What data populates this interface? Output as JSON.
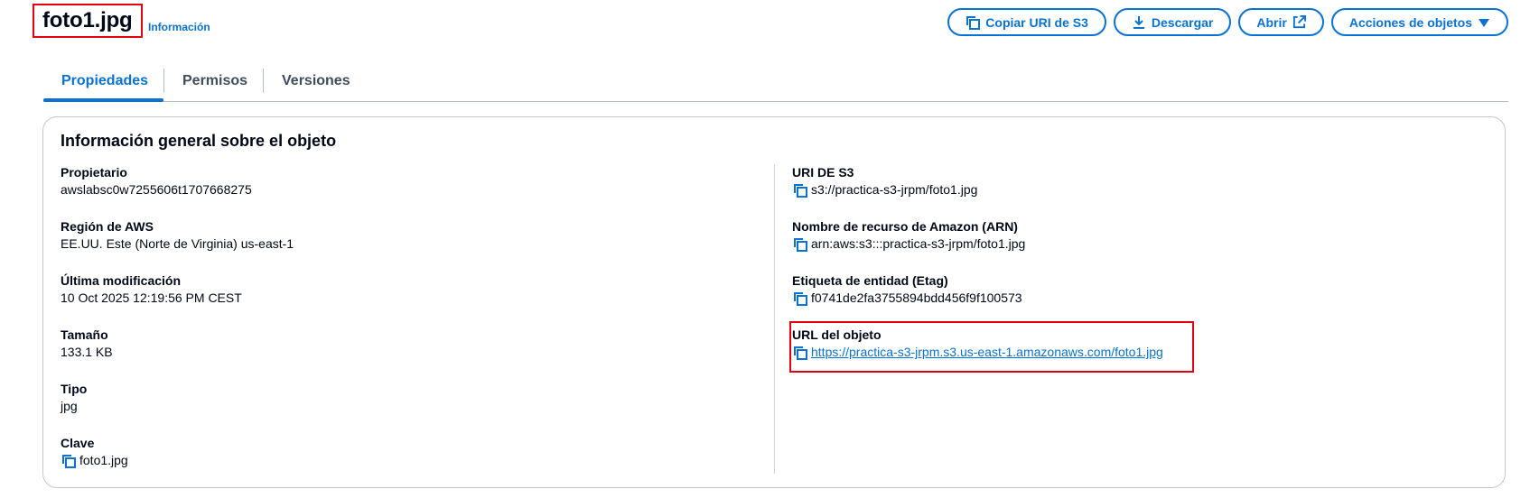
{
  "header": {
    "title": "foto1.jpg",
    "info_link": "Información",
    "buttons": {
      "copy_uri": "Copiar URI de S3",
      "download": "Descargar",
      "open": "Abrir",
      "actions": "Acciones de objetos"
    }
  },
  "tabs": [
    {
      "label": "Propiedades",
      "active": true
    },
    {
      "label": "Permisos",
      "active": false
    },
    {
      "label": "Versiones",
      "active": false
    }
  ],
  "overview": {
    "title": "Información general sobre el objeto",
    "left": [
      {
        "label": "Propietario",
        "value": "awslabsc0w7255606t1707668275"
      },
      {
        "label": "Región de AWS",
        "value": "EE.UU. Este (Norte de Virginia) us-east-1"
      },
      {
        "label": "Última modificación",
        "value": "10 Oct 2025 12:19:56 PM CEST"
      },
      {
        "label": "Tamaño",
        "value": "133.1 KB"
      },
      {
        "label": "Tipo",
        "value": "jpg"
      },
      {
        "label": "Clave",
        "value": "foto1.jpg"
      }
    ],
    "right": [
      {
        "label": "URI DE S3",
        "value": "s3://practica-s3-jrpm/foto1.jpg"
      },
      {
        "label": "Nombre de recurso de Amazon (ARN)",
        "value": "arn:aws:s3:::practica-s3-jrpm/foto1.jpg"
      },
      {
        "label": "Etiqueta de entidad (Etag)",
        "value": "f0741de2fa3755894bdd456f9f100573"
      },
      {
        "label": "URL del objeto",
        "value": "https://practica-s3-jrpm.s3.us-east-1.amazonaws.com/foto1.jpg"
      }
    ]
  },
  "colors": {
    "accent": "#0972d3",
    "highlight": "#e3000f",
    "text": "#000716"
  },
  "icons": [
    "copy-icon",
    "download-icon",
    "external-link-icon",
    "caret-down-icon"
  ]
}
